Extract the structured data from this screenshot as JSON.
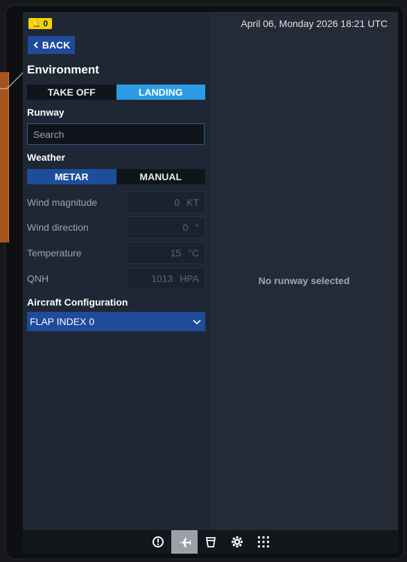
{
  "status": {
    "badge_icon": "bell-icon",
    "badge_count": "0",
    "datetime": "April 06, Monday 2026 18:21 UTC"
  },
  "back_label": "BACK",
  "title": "Environment",
  "phase_tabs": [
    {
      "label": "TAKE OFF",
      "active": false
    },
    {
      "label": "LANDING",
      "active": true
    }
  ],
  "runway": {
    "label": "Runway",
    "search_placeholder": "Search"
  },
  "weather": {
    "label": "Weather",
    "tabs": [
      {
        "label": "METAR",
        "active": true
      },
      {
        "label": "MANUAL",
        "active": false
      }
    ],
    "fields": [
      {
        "label": "Wind magnitude",
        "value": "0",
        "unit": "KT"
      },
      {
        "label": "Wind direction",
        "value": "0",
        "unit": "°"
      },
      {
        "label": "Temperature",
        "value": "15",
        "unit": "°C"
      },
      {
        "label": "QNH",
        "value": "1013",
        "unit": "HPA"
      }
    ]
  },
  "aircraft_config": {
    "label": "Aircraft Configuration",
    "selected": "FLAP INDEX 0"
  },
  "right_panel": {
    "message": "No runway selected"
  },
  "bottom_nav": [
    {
      "icon": "info-icon",
      "active": false
    },
    {
      "icon": "airplane-icon",
      "active": true
    },
    {
      "icon": "cup-icon",
      "active": false
    },
    {
      "icon": "gear-icon",
      "active": false
    },
    {
      "icon": "apps-grid-icon",
      "active": false
    }
  ],
  "colors": {
    "accent_blue": "#1f4b9a",
    "accent_cyan": "#2c9be6",
    "badge_yellow": "#f4d400",
    "side_tab_orange": "#a5541d"
  }
}
